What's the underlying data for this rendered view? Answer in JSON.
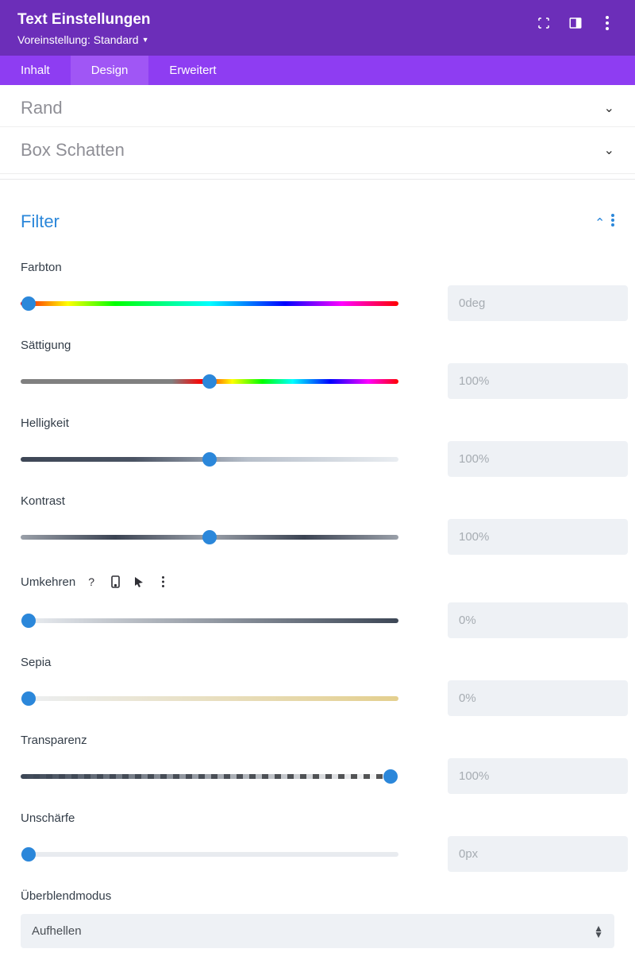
{
  "header": {
    "title": "Text Einstellungen",
    "preset_label": "Voreinstellung: Standard"
  },
  "tabs": {
    "content": "Inhalt",
    "design": "Design",
    "advanced": "Erweitert"
  },
  "accordions": {
    "border": "Rand",
    "box_shadow": "Box Schatten",
    "filter": "Filter"
  },
  "filters": {
    "hue": {
      "label": "Farbton",
      "value": "0deg",
      "thumb_pct": 2
    },
    "saturation": {
      "label": "Sättigung",
      "value": "100%",
      "thumb_pct": 50
    },
    "brightness": {
      "label": "Helligkeit",
      "value": "100%",
      "thumb_pct": 50
    },
    "contrast": {
      "label": "Kontrast",
      "value": "100%",
      "thumb_pct": 50
    },
    "invert": {
      "label": "Umkehren",
      "value": "0%",
      "thumb_pct": 2
    },
    "sepia": {
      "label": "Sepia",
      "value": "0%",
      "thumb_pct": 2
    },
    "opacity": {
      "label": "Transparenz",
      "value": "100%",
      "thumb_pct": 98
    },
    "blur": {
      "label": "Unschärfe",
      "value": "0px",
      "thumb_pct": 2
    }
  },
  "blend": {
    "label": "Überblendmodus",
    "selected": "Aufhellen"
  }
}
